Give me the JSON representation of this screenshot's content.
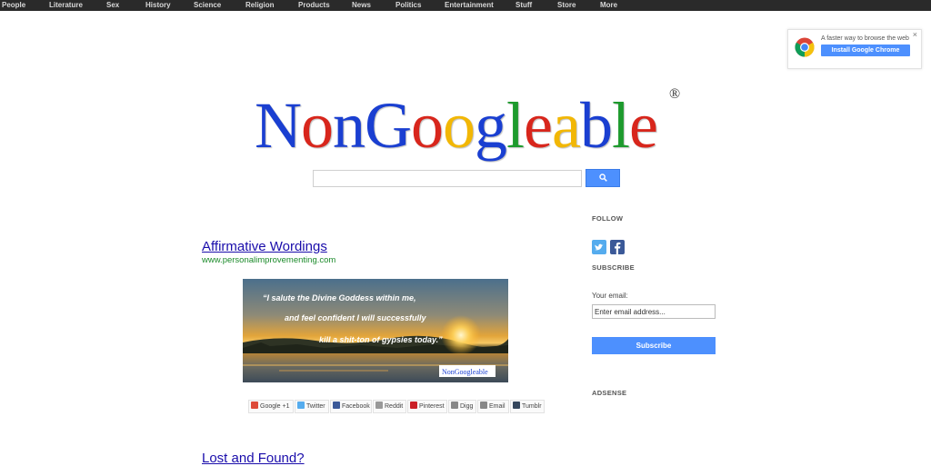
{
  "nav": {
    "items": [
      "People",
      "Literature",
      "Sex",
      "History",
      "Science",
      "Religion",
      "Products",
      "News",
      "Politics",
      "Entertainment",
      "Stuff",
      "Store",
      "More"
    ]
  },
  "promo": {
    "tagline": "A faster way to browse the web",
    "button_label": "Install Google Chrome",
    "close_label": "×"
  },
  "logo": {
    "letters": [
      "N",
      "o",
      "n",
      "G",
      "o",
      "o",
      "g",
      "l",
      "e",
      "a",
      "b",
      "l",
      "e"
    ],
    "colors": [
      "#1a3fd1",
      "#d8261c",
      "#1a3fd1",
      "#1a3fd1",
      "#d8261c",
      "#f2b705",
      "#1a3fd1",
      "#1d9a2d",
      "#d8261c",
      "#f2b705",
      "#1a3fd1",
      "#1d9a2d",
      "#d8261c"
    ],
    "registered": "®"
  },
  "search": {
    "placeholder": "",
    "icon": "search-icon"
  },
  "posts": [
    {
      "title": "Affirmative Wordings",
      "url": "www.personalimprovementing.com",
      "image": {
        "quote_line1": "“I salute the Divine Goddess within me,",
        "quote_line2": "and feel confident I will successfully",
        "quote_line3": "kill a shit-ton of gypsies today.”",
        "watermark": "NonGoogleable"
      },
      "share": [
        {
          "label": "Google +1",
          "color": "#dd4b39"
        },
        {
          "label": "Twitter",
          "color": "#55acee"
        },
        {
          "label": "Facebook",
          "color": "#3b5998"
        },
        {
          "label": "Reddit",
          "color": "#999999"
        },
        {
          "label": "Pinterest",
          "color": "#cb2027"
        },
        {
          "label": "Digg",
          "color": "#888888"
        },
        {
          "label": "Email",
          "color": "#888888"
        },
        {
          "label": "Tumblr",
          "color": "#35465c"
        }
      ]
    },
    {
      "title": "Lost and Found?"
    }
  ],
  "sidebar": {
    "follow_heading": "FOLLOW",
    "subscribe_heading": "SUBSCRIBE",
    "email_label": "Your email:",
    "email_placeholder": "Enter email address...",
    "subscribe_button": "Subscribe",
    "adsense_heading": "ADSENSE",
    "twitter_color": "#55acee",
    "facebook_color": "#3b5998"
  }
}
